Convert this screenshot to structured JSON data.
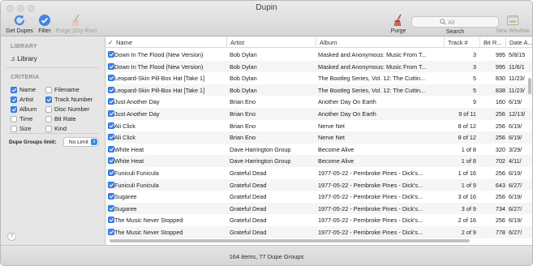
{
  "window": {
    "title": "Dupin"
  },
  "toolbar": {
    "get_dupes_label": "Get Dupes",
    "filter_label": "Filter",
    "purge_dry_label": "Purge (Dry Run)",
    "purge_label": "Purge",
    "search_label": "Search",
    "search_placeholder": "All",
    "new_window_label": "New Window"
  },
  "sidebar": {
    "library_title": "LIBRARY",
    "library_item": "Library",
    "criteria_title": "CRITERIA",
    "criteria": [
      {
        "label": "Name",
        "checked": true
      },
      {
        "label": "Filename",
        "checked": false
      },
      {
        "label": "Artist",
        "checked": true
      },
      {
        "label": "Track Number",
        "checked": true
      },
      {
        "label": "Album",
        "checked": true
      },
      {
        "label": "Disc Number",
        "checked": false
      },
      {
        "label": "Time",
        "checked": false
      },
      {
        "label": "Bit Rate",
        "checked": false
      },
      {
        "label": "Size",
        "checked": false
      },
      {
        "label": "Kind",
        "checked": false
      }
    ],
    "dupe_groups_label": "Dupe Groups limit:",
    "dupe_groups_value": "No Limit",
    "help": "?"
  },
  "table": {
    "columns": [
      "Name",
      "Artist",
      "Album",
      "Track #",
      "Bit R...",
      "Date A..."
    ],
    "check_header": "✓",
    "rows": [
      {
        "name": "Down In The Flood (New Version)",
        "artist": "Bob Dylan",
        "album": "Masked and Anonymous: Music From T...",
        "track": "3",
        "bitrate": "995",
        "date": "5/8/15"
      },
      {
        "name": "Down In The Flood (New Version)",
        "artist": "Bob Dylan",
        "album": "Masked and Anonymous: Music From T...",
        "track": "3",
        "bitrate": "995",
        "date": "11/6/1"
      },
      {
        "name": "Leopard-Skin Pill-Box Hat [Take 1]",
        "artist": "Bob Dylan",
        "album": "The Bootleg Series, Vol. 12: The Cuttin...",
        "track": "5",
        "bitrate": "830",
        "date": "11/23/"
      },
      {
        "name": "Leopard-Skin Pill-Box Hat [Take 1]",
        "artist": "Bob Dylan",
        "album": "The Bootleg Series, Vol. 12: The Cuttin...",
        "track": "5",
        "bitrate": "838",
        "date": "11/23/"
      },
      {
        "name": "Just Another Day",
        "artist": "Brian Eno",
        "album": "Another Day On Earth",
        "track": "9",
        "bitrate": "160",
        "date": "6/19/"
      },
      {
        "name": "Just Another Day",
        "artist": "Brian Eno",
        "album": "Another Day On Earth",
        "track": "9 of 11",
        "bitrate": "256",
        "date": "12/13/"
      },
      {
        "name": "Ali Click",
        "artist": "Brian Eno",
        "album": "Nerve Net",
        "track": "8 of 12",
        "bitrate": "256",
        "date": "6/19/"
      },
      {
        "name": "Ali Click",
        "artist": "Brian Eno",
        "album": "Nerve Net",
        "track": "8 of 12",
        "bitrate": "256",
        "date": "6/19/"
      },
      {
        "name": "White Heat",
        "artist": "Dave Harrington Group",
        "album": "Become Alive",
        "track": "1 of 8",
        "bitrate": "320",
        "date": "3/29/"
      },
      {
        "name": "White Heat",
        "artist": "Dave Harrington Group",
        "album": "Become Alive",
        "track": "1 of 8",
        "bitrate": "702",
        "date": "4/11/"
      },
      {
        "name": "Funiculi Funicula",
        "artist": "Grateful Dead",
        "album": "1977-05-22 - Pembroke Pines - Dick's...",
        "track": "1 of 16",
        "bitrate": "256",
        "date": "6/19/"
      },
      {
        "name": "Funiculi Funicula",
        "artist": "Grateful Dead",
        "album": "1977-05-22 - Pembroke Pines - Dick's...",
        "track": "1 of 9",
        "bitrate": "643",
        "date": "6/27/"
      },
      {
        "name": "Sugaree",
        "artist": "Grateful Dead",
        "album": "1977-05-22 - Pembroke Pines - Dick's...",
        "track": "3 of 16",
        "bitrate": "256",
        "date": "6/19/"
      },
      {
        "name": "Sugaree",
        "artist": "Grateful Dead",
        "album": "1977-05-22 - Pembroke Pines - Dick's...",
        "track": "3 of 9",
        "bitrate": "734",
        "date": "6/27/"
      },
      {
        "name": "The Music Never Stopped",
        "artist": "Grateful Dead",
        "album": "1977-05-22 - Pembroke Pines - Dick's...",
        "track": "2 of 16",
        "bitrate": "256",
        "date": "6/19/"
      },
      {
        "name": "The Music Never Stopped",
        "artist": "Grateful Dead",
        "album": "1977-05-22 - Pembroke Pines - Dick's...",
        "track": "2 of 9",
        "bitrate": "778",
        "date": "6/27/"
      }
    ]
  },
  "status": {
    "text": "164 items, 77 Dupe Groups"
  },
  "icons": {
    "get_dupes": "refresh-icon",
    "filter": "checkmark-badge-icon",
    "purge_dry": "broom-icon",
    "purge": "broom-icon",
    "search": "magnifier-icon",
    "new_window": "window-icon",
    "library": "music-note-icon"
  },
  "colors": {
    "accent": "#3c86ea",
    "purge_icon": "#c0392b"
  }
}
